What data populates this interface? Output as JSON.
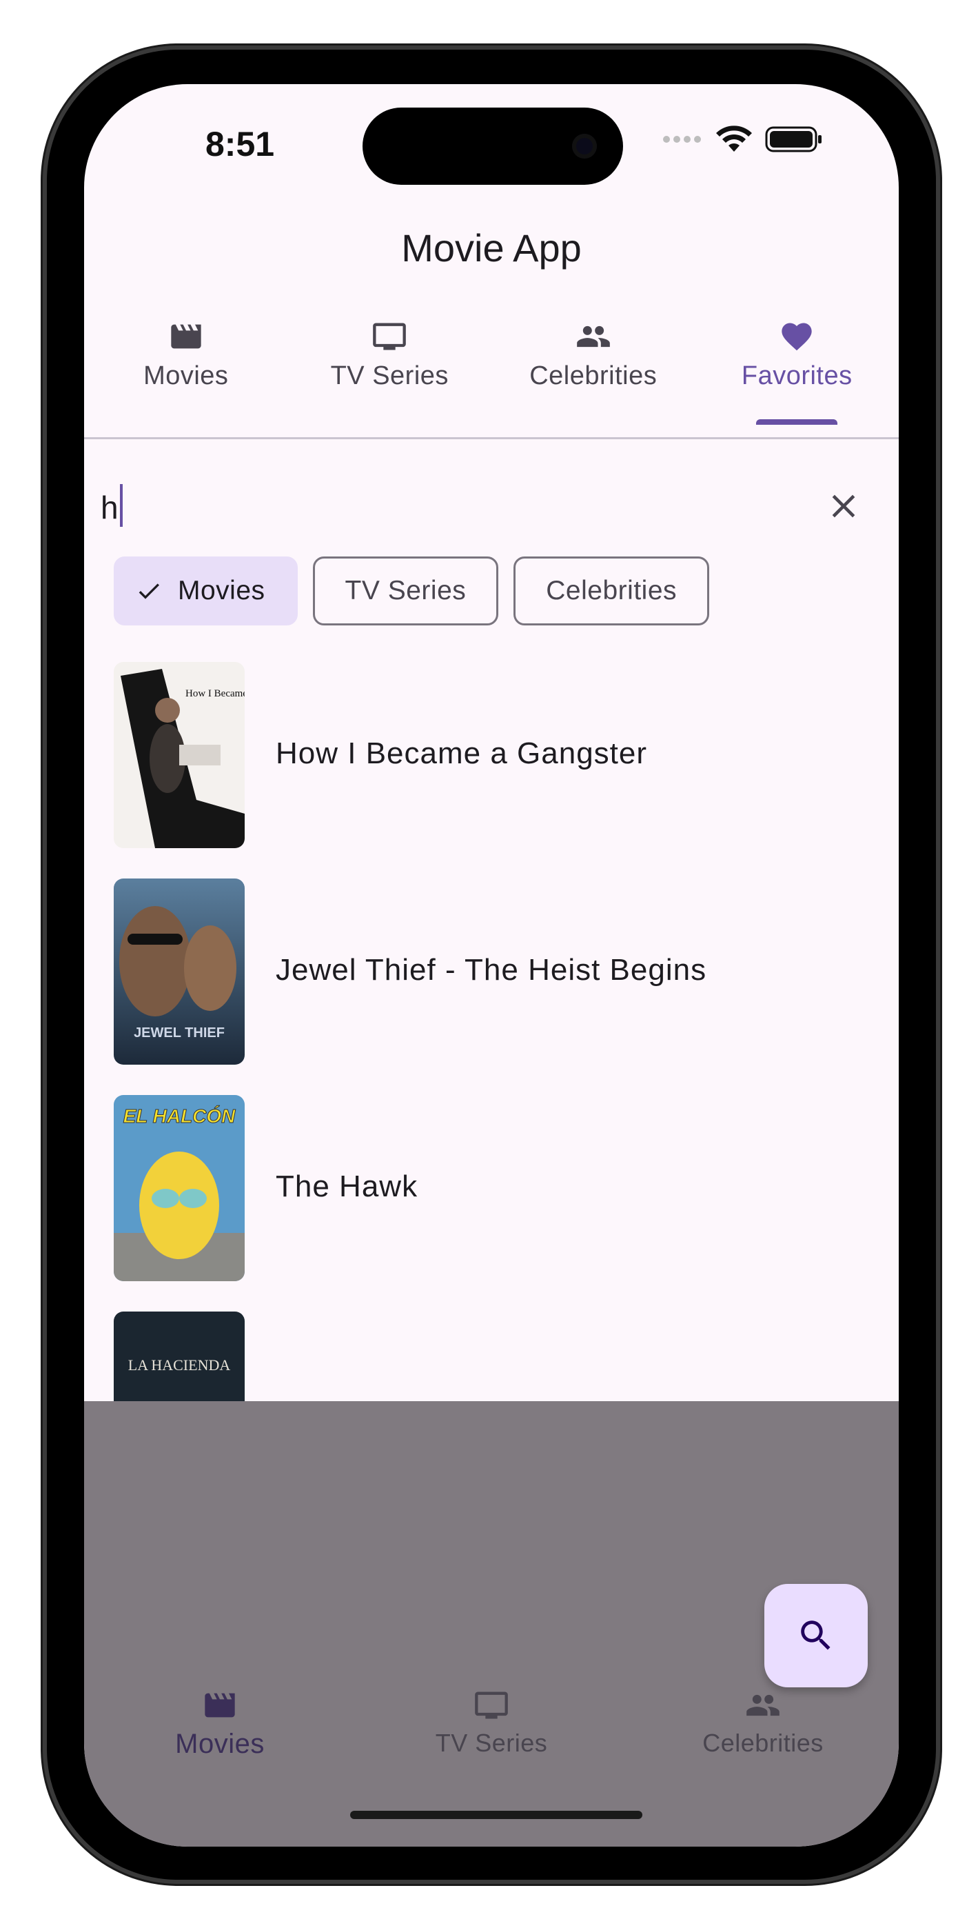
{
  "status_bar": {
    "time": "8:51"
  },
  "app": {
    "title": "Movie App"
  },
  "tabs": [
    {
      "label": "Movies",
      "icon": "movie-clapper-icon",
      "active": false
    },
    {
      "label": "TV Series",
      "icon": "tv-icon",
      "active": false
    },
    {
      "label": "Celebrities",
      "icon": "people-icon",
      "active": false
    },
    {
      "label": "Favorites",
      "icon": "heart-icon",
      "active": true
    }
  ],
  "search": {
    "value": "h"
  },
  "chips": [
    {
      "label": "Movies",
      "selected": true
    },
    {
      "label": "TV Series",
      "selected": false
    },
    {
      "label": "Celebrities",
      "selected": false
    }
  ],
  "results": [
    {
      "title": "How I Became a Gangster",
      "poster_text": "How I Became a GANGSTER"
    },
    {
      "title": "Jewel Thief - The Heist Begins",
      "poster_text": "JEWEL THIEF"
    },
    {
      "title": "The Hawk",
      "poster_text": "EL HALCÓN"
    },
    {
      "title": "",
      "poster_text": "LA HACIENDA"
    }
  ],
  "bottom_nav": [
    {
      "label": "Movies",
      "icon": "movie-clapper-icon",
      "active": true
    },
    {
      "label": "TV Series",
      "icon": "tv-icon",
      "active": false
    },
    {
      "label": "Celebrities",
      "icon": "people-icon",
      "active": false
    }
  ],
  "fab": {
    "icon": "search-icon"
  },
  "colors": {
    "primary": "#6750a4",
    "surface": "#fdf7fc",
    "chip_selected": "#e8def8",
    "fab": "#eaddff",
    "scrim": "#807a80"
  }
}
